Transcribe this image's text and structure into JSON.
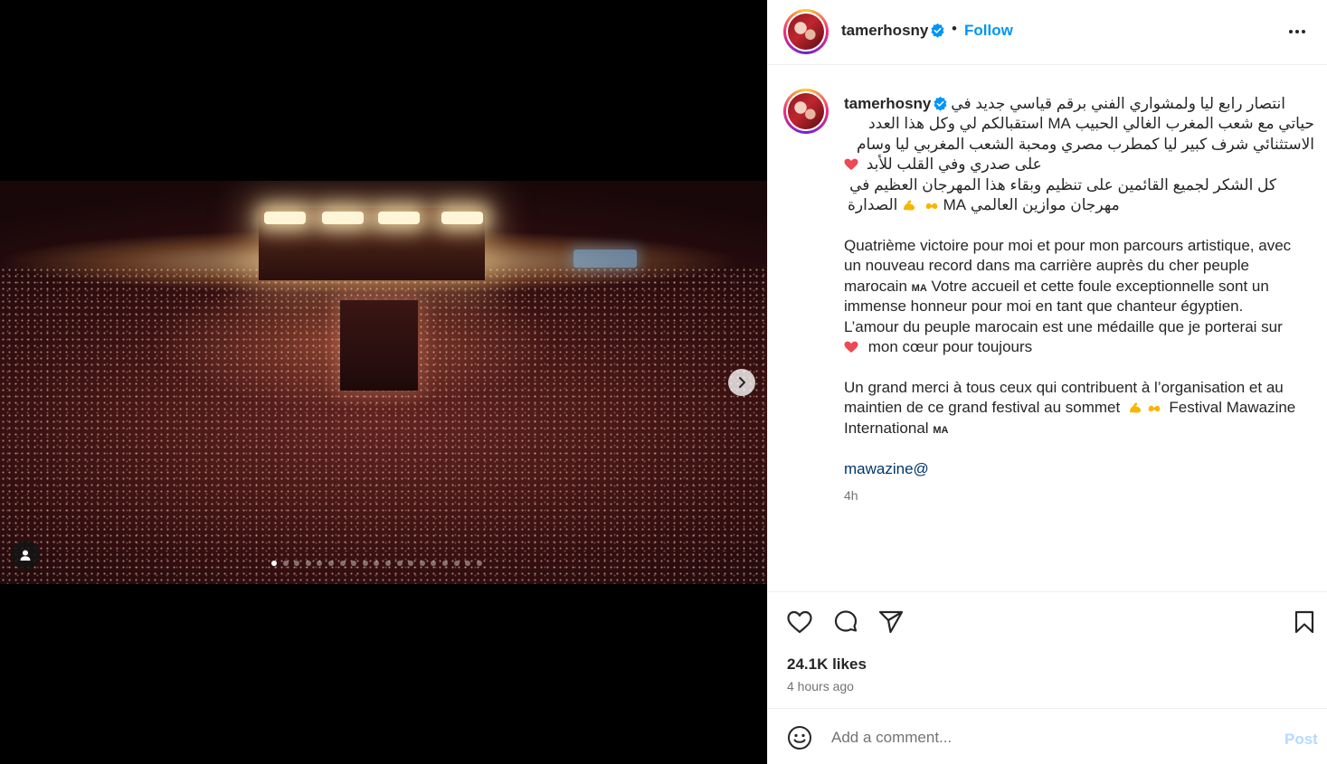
{
  "post": {
    "username": "tamerhosny",
    "follow_label": "Follow",
    "separator": "•",
    "caption": {
      "ar_line1": "انتصار رابع ليا ولمشواري الفني برقم قياسي جديد في",
      "ar_line2": "حياتي مع شعب المغرب الغالي الحبيب MA استقبالكم لي وكل هذا العدد",
      "ar_line3": "الاستثنائي شرف كبير ليا كمطرب مصري ومحبة الشعب المغربي ليا وسام",
      "ar_line4": "على صدري وفي القلب للأبد",
      "ar_line5": "كل الشكر لجميع القائمين على تنظيم وبقاء هذا المهرجان العظيم في",
      "ar_line6a": "الصدارة",
      "ar_line6b": "مهرجان موازين العالمي MA",
      "fr_line1": "Quatrième victoire pour moi et pour mon parcours artistique, avec",
      "fr_line2": "un nouveau record dans ma carrière auprès du cher peuple",
      "fr_line3a": "marocain",
      "fr_line3b": "MA",
      "fr_line3c": "Votre accueil et cette foule exceptionnelle sont un",
      "fr_line4": "immense honneur pour moi en tant que chanteur égyptien.",
      "fr_line5": "L’amour du peuple marocain est une médaille que je porterai sur",
      "fr_line6": "mon cœur pour toujours",
      "fr_line7": "Un grand merci à tous ceux qui contribuent à l’organisation et au",
      "fr_line8a": "maintien de ce grand festival au sommet",
      "fr_line8b": "Festival Mawazine",
      "fr_line9a": "International",
      "fr_line9b": "MA",
      "mention": "mawazine@",
      "time": "4h"
    },
    "likes": "24.1K likes",
    "time_ago": "4 hours ago",
    "comment_placeholder": "Add a comment...",
    "post_label": "Post",
    "carousel": {
      "total": 19,
      "current": 1
    }
  },
  "colors": {
    "link_blue": "#0095f6",
    "heart_red": "#ed4956",
    "post_disabled": "#b3dbff"
  },
  "icons": [
    "verified-badge-icon",
    "more-icon",
    "chevron-right-icon",
    "user-tag-icon",
    "heart-icon",
    "comment-icon",
    "share-icon",
    "bookmark-icon",
    "emoji-icon"
  ]
}
